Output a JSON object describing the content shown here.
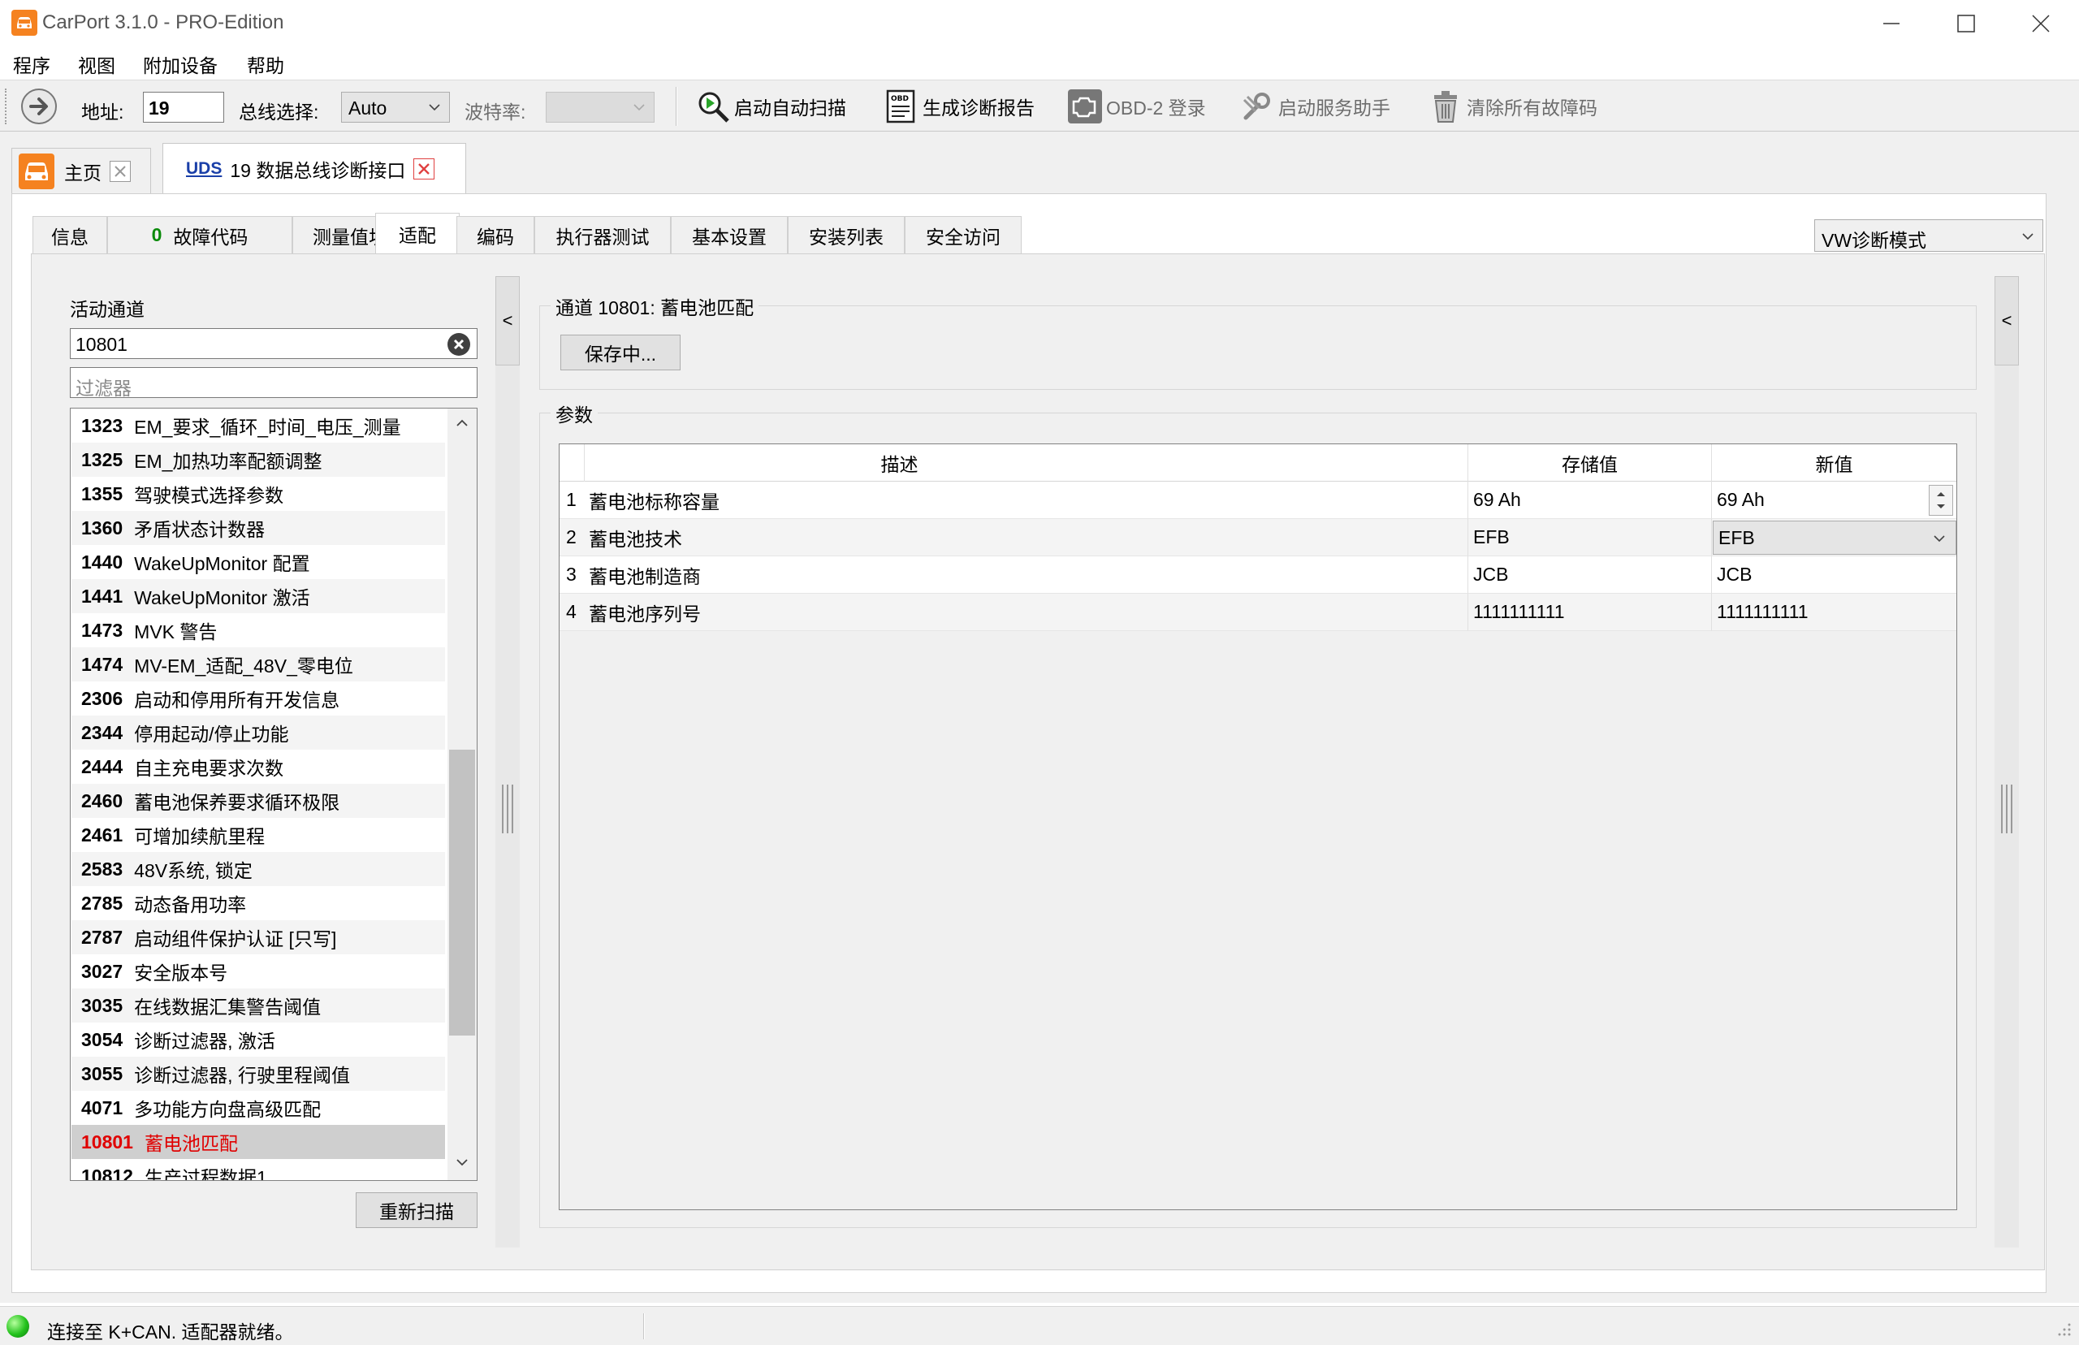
{
  "window": {
    "title": "CarPort 3.1.0 - PRO-Edition",
    "accent_color": "#f58220"
  },
  "menu": [
    "程序",
    "视图",
    "附加设备",
    "帮助"
  ],
  "toolbar": {
    "address_label": "地址:",
    "address_value": "19",
    "bus_label": "总线选择:",
    "bus_value": "Auto",
    "baud_label": "波特率:",
    "baud_value": "",
    "actions": [
      {
        "label": "启动自动扫描",
        "icon": "magnifier-scan-icon",
        "enabled": true
      },
      {
        "label": "生成诊断报告",
        "icon": "obd-report-icon",
        "enabled": true
      },
      {
        "label": "OBD-2 登录",
        "icon": "engine-icon",
        "enabled": false
      },
      {
        "label": "启动服务助手",
        "icon": "wrench-icon",
        "enabled": false
      },
      {
        "label": "清除所有故障码",
        "icon": "trash-icon",
        "enabled": false
      }
    ]
  },
  "doc_tabs": [
    {
      "label": "主页",
      "icon": "car-icon"
    },
    {
      "prefix": "UDS",
      "label": "19 数据总线诊断接口"
    }
  ],
  "inner_tabs": [
    "信息",
    "故障代码",
    "测量值块",
    "适配",
    "编码",
    "执行器测试",
    "基本设置",
    "安装列表",
    "安全访问"
  ],
  "fault_count": "0",
  "active_inner_tab": "适配",
  "diag_mode": "VW诊断模式",
  "left_pane": {
    "active_channel_label": "活动通道",
    "channel_value": "10801",
    "filter_placeholder": "过滤器",
    "channels": [
      {
        "num": "1323",
        "name": "EM_要求_循环_时间_电压_测量"
      },
      {
        "num": "1325",
        "name": "EM_加热功率配额调整"
      },
      {
        "num": "1355",
        "name": "驾驶模式选择参数"
      },
      {
        "num": "1360",
        "name": "矛盾状态计数器"
      },
      {
        "num": "1440",
        "name": "WakeUpMonitor 配置"
      },
      {
        "num": "1441",
        "name": "WakeUpMonitor 激活"
      },
      {
        "num": "1473",
        "name": "MVK 警告"
      },
      {
        "num": "1474",
        "name": "MV-EM_适配_48V_零电位"
      },
      {
        "num": "2306",
        "name": "启动和停用所有开发信息"
      },
      {
        "num": "2344",
        "name": "停用起动/停止功能"
      },
      {
        "num": "2444",
        "name": "自主充电要求次数"
      },
      {
        "num": "2460",
        "name": "蓄电池保养要求循环极限"
      },
      {
        "num": "2461",
        "name": "可增加续航里程"
      },
      {
        "num": "2583",
        "name": "48V系统, 锁定"
      },
      {
        "num": "2785",
        "name": "动态备用功率"
      },
      {
        "num": "2787",
        "name": "启动组件保护认证 [只写]"
      },
      {
        "num": "3027",
        "name": "安全版本号"
      },
      {
        "num": "3035",
        "name": "在线数据汇集警告阈值"
      },
      {
        "num": "3054",
        "name": "诊断过滤器, 激活"
      },
      {
        "num": "3055",
        "name": "诊断过滤器, 行驶里程阈值"
      },
      {
        "num": "4071",
        "name": "多功能方向盘高级匹配"
      },
      {
        "num": "10801",
        "name": "蓄电池匹配"
      },
      {
        "num": "10812",
        "name": "生产过程数据1"
      }
    ],
    "selected_channel": "10801",
    "rescan_label": "重新扫描"
  },
  "right_pane": {
    "channel_title": "通道 10801: 蓄电池匹配",
    "saving_label": "保存中...",
    "params_title": "参数",
    "columns": [
      "描述",
      "存储值",
      "新值"
    ],
    "rows": [
      {
        "idx": "1",
        "desc": "蓄电池标称容量",
        "stored": "69 Ah",
        "new": "69 Ah",
        "editor": "spinner"
      },
      {
        "idx": "2",
        "desc": "蓄电池技术",
        "stored": "EFB",
        "new": "EFB",
        "editor": "dropdown"
      },
      {
        "idx": "3",
        "desc": "蓄电池制造商",
        "stored": "JCB",
        "new": "JCB",
        "editor": "text"
      },
      {
        "idx": "4",
        "desc": "蓄电池序列号",
        "stored": "1111111111",
        "new": "1111111111",
        "editor": "text"
      }
    ]
  },
  "collapse_label": "<",
  "status": {
    "text": "连接至 K+CAN. 适配器就绪。",
    "led_color": "#23c21c"
  }
}
